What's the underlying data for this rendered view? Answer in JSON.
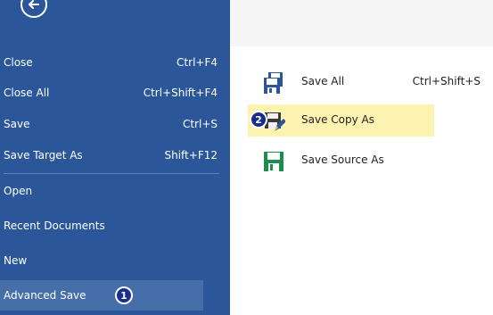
{
  "menu": {
    "items": [
      {
        "label": "Close",
        "shortcut": "Ctrl+F4"
      },
      {
        "label": "Close All",
        "shortcut": "Ctrl+Shift+F4"
      },
      {
        "label": "Save",
        "shortcut": "Ctrl+S"
      },
      {
        "label": "Save Target As",
        "shortcut": "Shift+F12"
      },
      {
        "label": "Open",
        "shortcut": ""
      },
      {
        "label": "Recent Documents",
        "shortcut": ""
      },
      {
        "label": "New",
        "shortcut": ""
      },
      {
        "label": "Advanced Save",
        "shortcut": ""
      }
    ],
    "selected_badge": "1"
  },
  "save_options": [
    {
      "label": "Save All",
      "shortcut": "Ctrl+Shift+S",
      "icon": "save-all-icon"
    },
    {
      "label": "Save Copy As",
      "shortcut": "",
      "icon": "save-copy-as-icon",
      "badge": "2"
    },
    {
      "label": "Save Source As",
      "shortcut": "",
      "icon": "save-source-as-icon"
    }
  ],
  "colors": {
    "panel": "#2b579a",
    "selected": "#466ea8",
    "highlight": "#fcf3b0",
    "badge": "#1a2c8c"
  }
}
